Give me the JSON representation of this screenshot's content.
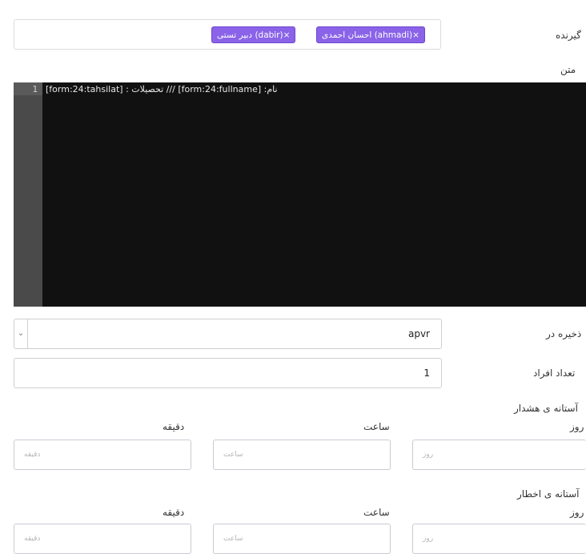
{
  "receivers": {
    "label": "گیرنده",
    "tags": [
      {
        "text": "احسان احمدی (ahmadi)×"
      },
      {
        "text": "دبیر تستی (dabir)×"
      }
    ]
  },
  "content_label": "متن",
  "editor": {
    "line_number": "1",
    "code": "نام: [form:24:fullname] /// تحصیلات : [form:24:tahsilat]"
  },
  "save_in": {
    "label": "ذخیره در",
    "value": "apvr"
  },
  "people_count": {
    "label": "تعداد افراد",
    "value": "1"
  },
  "warning_threshold": {
    "label": "آستانه ی هشدار",
    "day_label": "روز",
    "hour_label": "ساعت",
    "minute_label": "دقیقه",
    "day_placeholder": "روز",
    "hour_placeholder": "ساعت",
    "minute_placeholder": "دقیقه"
  },
  "alert_threshold": {
    "label": "آستانه ی اخطار",
    "day_label": "روز",
    "hour_label": "ساعت",
    "minute_label": "دقیقه",
    "day_placeholder": "روز",
    "hour_placeholder": "ساعت",
    "minute_placeholder": "دقیقه"
  }
}
